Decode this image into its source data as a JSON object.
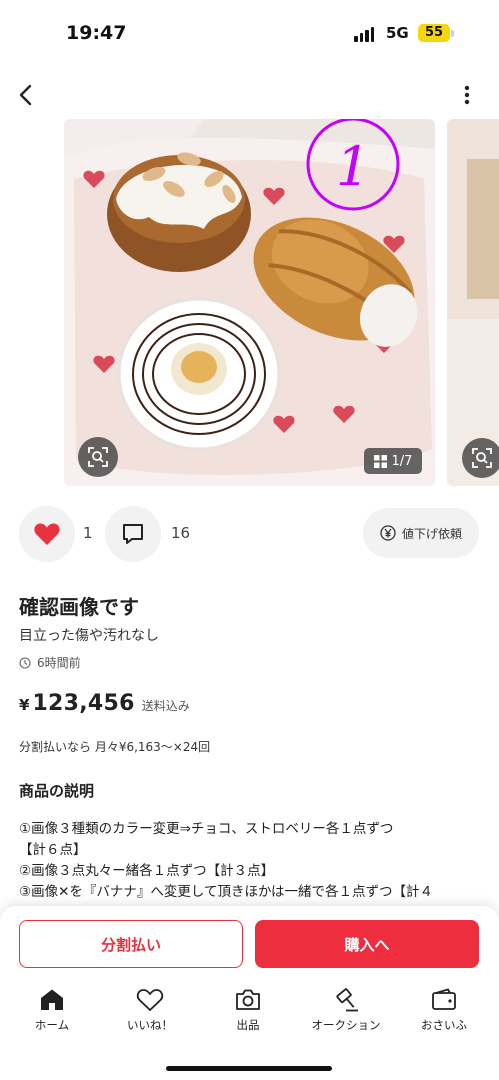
{
  "status_bar": {
    "time": "19:47",
    "network": "5G",
    "battery": "55"
  },
  "photo": {
    "counter": "1/7",
    "number_mark": "1",
    "accent": "#c400ff"
  },
  "actions": {
    "like_count": "1",
    "comment_count": "16",
    "price_down_label": "値下げ依頼"
  },
  "item": {
    "title": "確認画像です",
    "condition": "目立った傷や汚れなし",
    "posted": "6時間前",
    "price_symbol": "¥",
    "price": "123,456",
    "shipping": "送料込み",
    "installment": "分割払いなら 月々¥6,163〜×24回"
  },
  "description": {
    "heading": "商品の説明",
    "lines": [
      "①画像３種類のカラー変更⇒チョコ、ストロベリー各１点ずつ",
      "【計６点】",
      "②画像３点丸々ー緒各１点ずつ【計３点】",
      "③画像✕を『バナナ』へ変更して頂きほかは一緒で各１点ずつ【計４"
    ]
  },
  "buttons": {
    "split": "分割払い",
    "buy": "購入へ"
  },
  "tabs": [
    {
      "label": "ホーム",
      "icon": "home-icon"
    },
    {
      "label": "いいね！",
      "icon": "heart-outline-icon"
    },
    {
      "label": "出品",
      "icon": "camera-icon"
    },
    {
      "label": "オークション",
      "icon": "gavel-icon"
    },
    {
      "label": "おさいふ",
      "icon": "wallet-icon"
    }
  ],
  "colors": {
    "primary": "#ee2e3f",
    "like": "#e8323f"
  }
}
